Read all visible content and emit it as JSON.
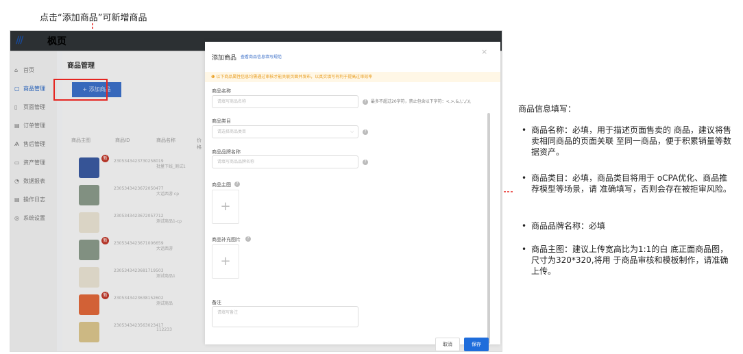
{
  "caption": "点击“添加商品”可新增商品",
  "app": {
    "logo": "///",
    "name": "枫页"
  },
  "sidebar": {
    "items": [
      {
        "icon": "⌂",
        "label": "首页"
      },
      {
        "icon": "▢",
        "label": "商品管理"
      },
      {
        "icon": "▯",
        "label": "页面管理"
      },
      {
        "icon": "▤",
        "label": "订单管理"
      },
      {
        "icon": "Ѧ",
        "label": "售后管理"
      },
      {
        "icon": "▭",
        "label": "资产管理"
      },
      {
        "icon": "◔",
        "label": "数据报表"
      },
      {
        "icon": "▤",
        "label": "操作日志"
      },
      {
        "icon": "◎",
        "label": "系统设置"
      }
    ]
  },
  "main": {
    "title": "商品管理",
    "add_button": "+ 添加商品",
    "columns": [
      "商品主图",
      "商品ID",
      "商品名称",
      "价格"
    ],
    "rows": [
      {
        "id": "2305343423730258019",
        "name": "批量下线_测试1",
        "thumb_color": "#3a5aa0",
        "new": true
      },
      {
        "id": "2305343423672050477",
        "name": "大话西游 cp",
        "thumb_color": "#8a9a8a",
        "new": false
      },
      {
        "id": "2305343423672057712",
        "name": "测试商品1-cp",
        "thumb_color": "#e8e2d2",
        "new": false
      },
      {
        "id": "2305343423671006659",
        "name": "大话西游",
        "thumb_color": "#8a9a8a",
        "new": true
      },
      {
        "id": "2305343423681719503",
        "name": "测试商品1",
        "thumb_color": "#e8e2d2",
        "new": false
      },
      {
        "id": "2305343423638152602",
        "name": "测试商品",
        "thumb_color": "#e0683a",
        "new": true
      },
      {
        "id": "2305343423563023417",
        "name": "112233",
        "thumb_color": "#d9c48c",
        "new": false
      }
    ]
  },
  "modal": {
    "title": "添加商品",
    "link": "查看商品信息填写规范",
    "close": "×",
    "warning": "❶ 以下商品属性信息均需通过审核才能关联页面并发布，以真实填写有利于提高过审效率",
    "fields": {
      "name_label": "商品名称",
      "name_placeholder": "请填写商品名称",
      "name_hint": "最多不超过20字符，禁止包含以下字符：<,>,&,\\,',/,\\\\",
      "category_label": "商品类目",
      "category_placeholder": "请选择商品类目",
      "brand_label": "商品品牌名称",
      "brand_placeholder": "请填写商品品牌名称",
      "main_image_label": "商品主图",
      "extra_image_label": "商品补充图片",
      "remark_label": "备注",
      "remark_placeholder": "请填写备注"
    },
    "plus": "+",
    "cancel": "取消",
    "save": "保存"
  },
  "instructions": {
    "title": "商品信息填写：",
    "bullets": [
      "商品名称：必填，用于描述页面售卖的 商品，建议将售卖相同商品的页面关联 至同一商品，便于积累销量等数据资产。",
      "商品类目：必填，商品类目将用于 oCPA优化、商品推荐模型等场景，请 准确填写，否则会存在被拒审风险。",
      "商品品牌名称：必填",
      "商品主图：建议上传宽高比为1:1的白 底正面商品图，尺寸为320*320,将用 于商品审核和模板制作，请准确上传。"
    ]
  },
  "colors": {
    "accent": "#1f6ddb",
    "highlight": "#e52520",
    "warning": "#e89d1f"
  }
}
